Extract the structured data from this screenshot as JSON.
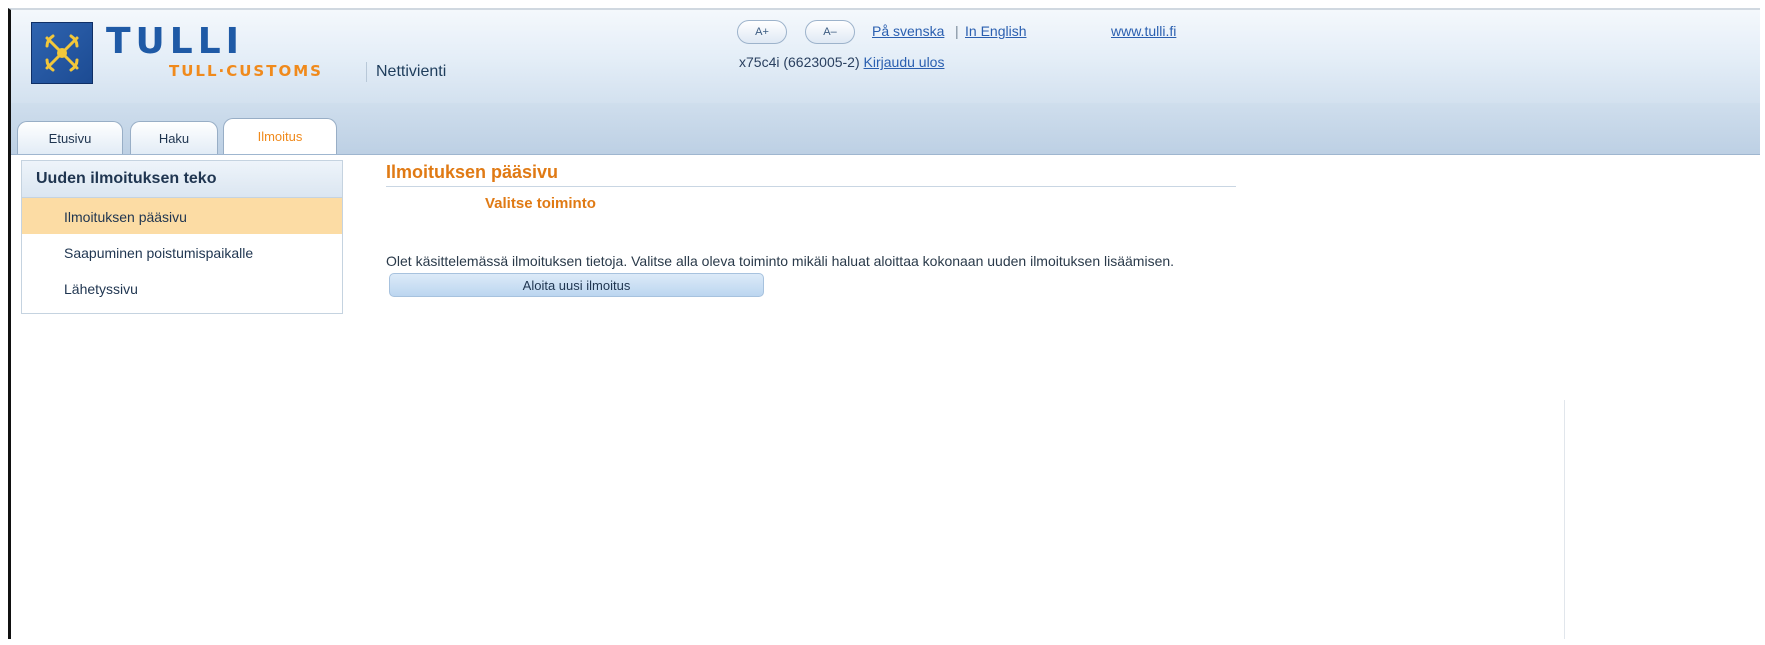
{
  "header": {
    "logo_title": "TULLI",
    "logo_subtitle": "TULL·CUSTOMS",
    "app_name": "Nettivienti",
    "font_increase": "A+",
    "font_decrease": "A–",
    "lang_swedish": "På svenska",
    "separator": "|",
    "lang_english": "In English",
    "website": "www.tulli.fi",
    "user_id": "x75c4i (6623005-2)",
    "logout": "Kirjaudu ulos"
  },
  "tabs": [
    {
      "label": "Etusivu",
      "active": false
    },
    {
      "label": "Haku",
      "active": false
    },
    {
      "label": "Ilmoitus",
      "active": true
    }
  ],
  "sidebar": {
    "heading": "Uuden ilmoituksen teko",
    "items": [
      {
        "label": "Ilmoituksen pääsivu",
        "active": true
      },
      {
        "label": "Saapuminen poistumispaikalle",
        "active": false
      },
      {
        "label": "Lähetyssivu",
        "active": false
      }
    ]
  },
  "main": {
    "title": "Ilmoituksen pääsivu",
    "subtitle": "Valitse toiminto",
    "info_text": "Olet käsittelemässä ilmoituksen tietoja. Valitse alla oleva toiminto mikäli haluat aloittaa kokonaan uuden ilmoituksen lisäämisen.",
    "action_button": "Aloita uusi ilmoitus"
  },
  "colors": {
    "brand_blue": "#1f5aa6",
    "accent_orange": "#f08a1c",
    "active_item_bg": "#fcdca4"
  }
}
